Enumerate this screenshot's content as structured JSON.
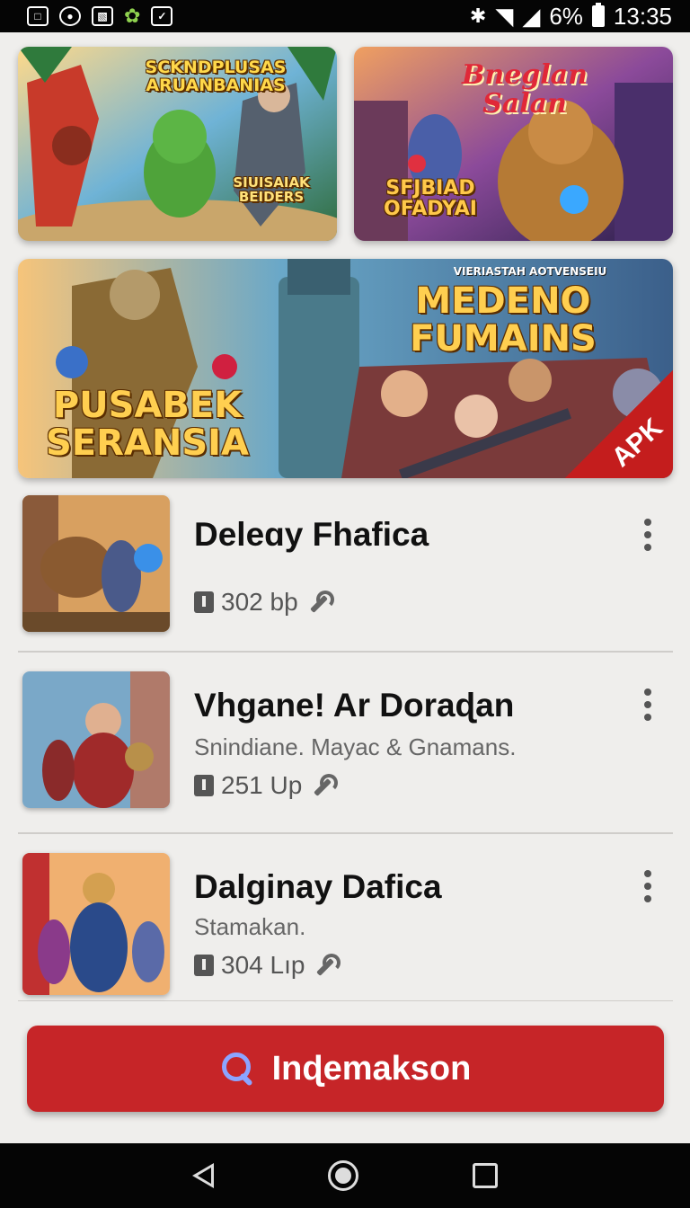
{
  "status_bar": {
    "battery": "6%",
    "time": "13:35",
    "notification_icons": [
      "calendar-icon",
      "camera-icon",
      "image-icon",
      "plant-icon",
      "chart-icon"
    ]
  },
  "banners": [
    {
      "title": "SCKNDPLUSAS ARUANBANIAS",
      "subtitle": "SIUISAIAK BEIDERS"
    },
    {
      "title": "Bneglan Salan",
      "subtitle": "SFJBIAD OFADYAI"
    },
    {
      "title_left": "PUSABEK SERANSIA",
      "kicker": "VIERIASTAH AOTVENSEIU",
      "title_right": "MEDENO FUMAINS",
      "badge": "APK"
    }
  ],
  "list": [
    {
      "title": "Deleɑy Fhafica",
      "subtitle": "",
      "meta": "302 bþ"
    },
    {
      "title": "Vhgane! Ar Doraɖan",
      "subtitle": "Snindiane. Mayac & Gnamans.",
      "meta": "251 Up"
    },
    {
      "title": "Dalginay Dafica",
      "subtitle": "Stamakan.",
      "meta": "304 Lıp"
    }
  ],
  "search_button": {
    "label": "Inɖemakson"
  },
  "colors": {
    "accent": "#c62528",
    "background": "#efeeec"
  }
}
